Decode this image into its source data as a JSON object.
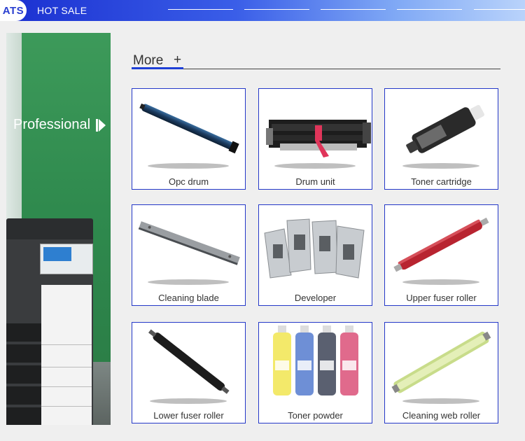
{
  "header": {
    "logo": "ATS",
    "title": "HOT SALE"
  },
  "banner": {
    "text": "Professional"
  },
  "section": {
    "more_label": "More",
    "more_plus": "+"
  },
  "products": [
    {
      "label": "Opc drum",
      "icon": "opc-drum-image"
    },
    {
      "label": "Drum unit",
      "icon": "drum-unit-image"
    },
    {
      "label": "Toner cartridge",
      "icon": "toner-cartridge-image"
    },
    {
      "label": "Cleaning blade",
      "icon": "cleaning-blade-image"
    },
    {
      "label": "Developer",
      "icon": "developer-image"
    },
    {
      "label": "Upper fuser roller",
      "icon": "upper-fuser-roller-image"
    },
    {
      "label": "Lower fuser roller",
      "icon": "lower-fuser-roller-image"
    },
    {
      "label": "Toner powder",
      "icon": "toner-powder-image"
    },
    {
      "label": "Cleaning web roller",
      "icon": "cleaning-web-roller-image"
    }
  ],
  "colors": {
    "header_blue": "#1a2fd0",
    "accent_blue": "#1e3fd6",
    "banner_green": "#2f8a4e",
    "card_border": "#2438c8"
  }
}
